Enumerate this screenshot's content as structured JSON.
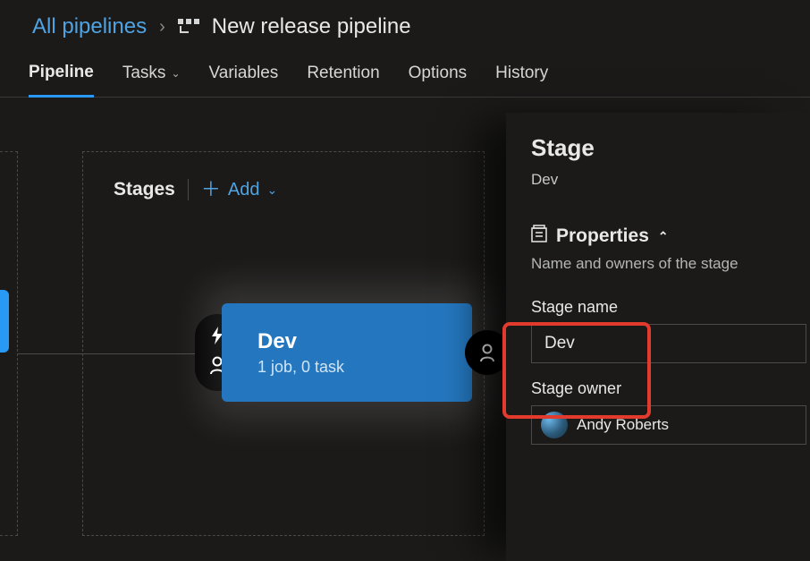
{
  "breadcrumb": {
    "root": "All pipelines",
    "current": "New release pipeline"
  },
  "tabs": {
    "pipeline": "Pipeline",
    "tasks": "Tasks",
    "variables": "Variables",
    "retention": "Retention",
    "options": "Options",
    "history": "History"
  },
  "stages": {
    "header": "Stages",
    "add": "Add"
  },
  "card": {
    "name": "Dev",
    "subtitle": "1 job, 0 task"
  },
  "panel": {
    "title": "Stage",
    "subtitle": "Dev",
    "section": "Properties",
    "section_desc": "Name and owners of the stage",
    "field_stage_name_label": "Stage name",
    "field_stage_name_value": "Dev",
    "field_owner_label": "Stage owner",
    "owner_name": "Andy Roberts"
  }
}
